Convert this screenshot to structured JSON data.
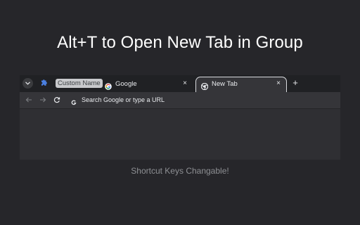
{
  "headline": "Alt+T to Open New Tab in Group",
  "caption": "Shortcut Keys Changable!",
  "browser": {
    "tab_search_icon": "chevron-down-icon",
    "extension_icon": "puzzle-icon",
    "group_label": "Custom Name",
    "tabs": [
      {
        "title": "Google",
        "icon": "google-g-icon",
        "close": "×",
        "active": false
      },
      {
        "title": "New Tab",
        "icon": "chrome-icon",
        "close": "×",
        "active": true
      }
    ],
    "new_tab_label": "+",
    "nav": {
      "back_icon": "arrow-left-icon",
      "forward_icon": "arrow-right-icon",
      "reload_icon": "reload-icon"
    },
    "omnibox": {
      "icon": "google-g-icon",
      "placeholder": "Search Google or type a URL"
    }
  },
  "colors": {
    "background": "#26262a",
    "tabstrip": "#202124",
    "toolbar": "#353539",
    "group_chip": "#c8c9cc",
    "active_tab_outline": "#dadce0",
    "extension_accent": "#4a7fe0"
  }
}
